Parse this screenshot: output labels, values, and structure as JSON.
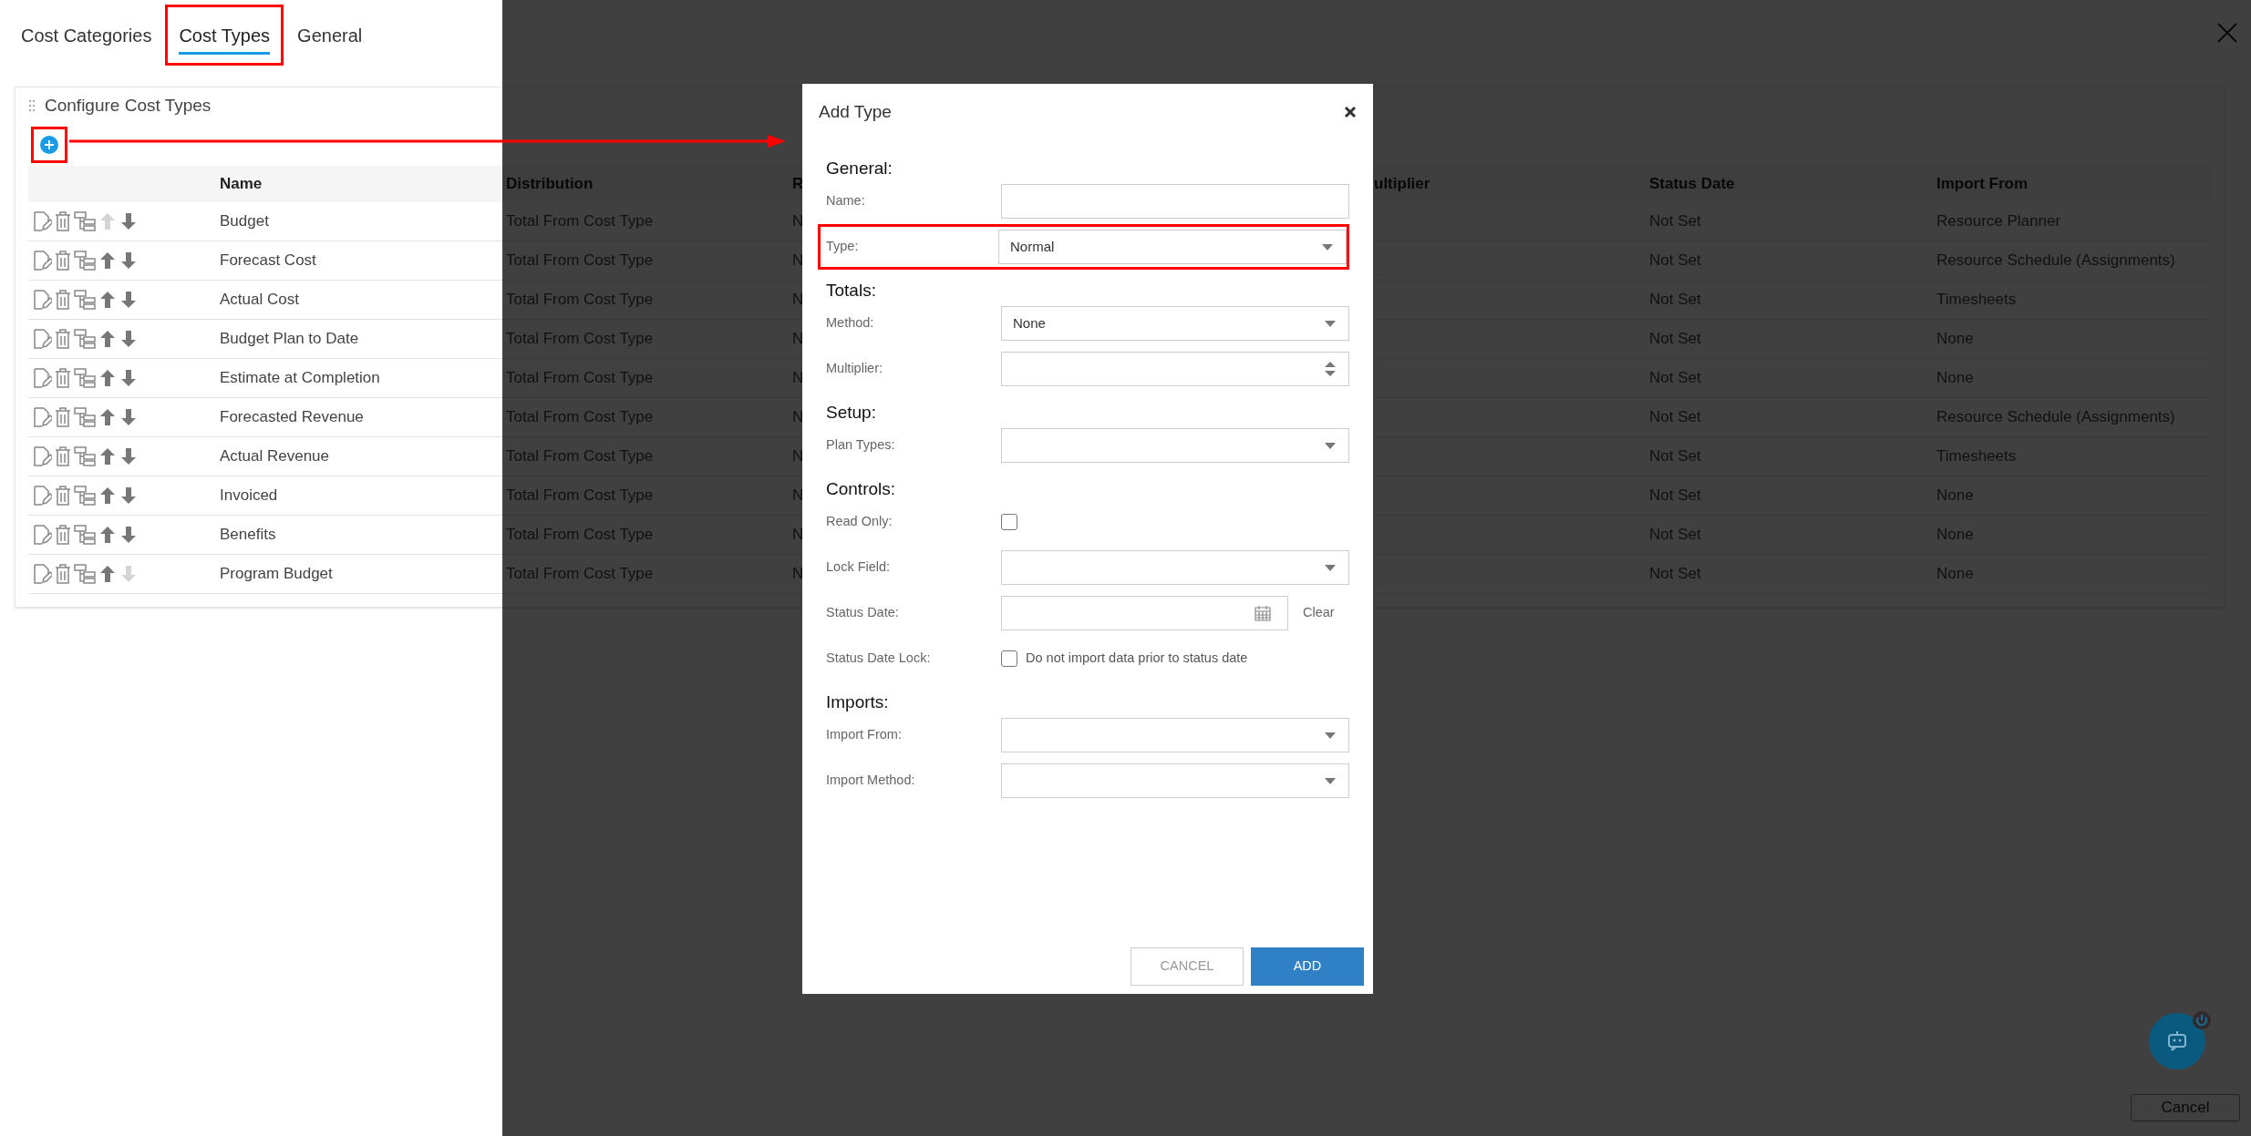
{
  "tabs": [
    {
      "label": "Cost Categories",
      "selected": false,
      "annotated": false
    },
    {
      "label": "Cost Types",
      "selected": true,
      "annotated": true
    },
    {
      "label": "General",
      "selected": false,
      "annotated": false
    }
  ],
  "panel": {
    "title": "Configure Cost Types",
    "add_button_annotated": true
  },
  "table": {
    "columns": [
      "Name",
      "Distribution",
      "R",
      "ultiplier",
      "Status Date",
      "Import From"
    ],
    "rows": [
      {
        "name": "Budget",
        "distribution": "Total From Cost Type",
        "column_3": "N",
        "status_date": "Not Set",
        "import_from": "Resource Planner",
        "can_move_up": false,
        "can_move_down": true
      },
      {
        "name": "Forecast Cost",
        "distribution": "Total From Cost Type",
        "column_3": "N",
        "status_date": "Not Set",
        "import_from": "Resource Schedule (Assignments)",
        "can_move_up": true,
        "can_move_down": true
      },
      {
        "name": "Actual Cost",
        "distribution": "Total From Cost Type",
        "column_3": "N",
        "status_date": "Not Set",
        "import_from": "Timesheets",
        "can_move_up": true,
        "can_move_down": true
      },
      {
        "name": "Budget Plan to Date",
        "distribution": "Total From Cost Type",
        "column_3": "N",
        "status_date": "Not Set",
        "import_from": "None",
        "can_move_up": true,
        "can_move_down": true
      },
      {
        "name": "Estimate at Completion",
        "distribution": "Total From Cost Type",
        "column_3": "N",
        "status_date": "Not Set",
        "import_from": "None",
        "can_move_up": true,
        "can_move_down": true
      },
      {
        "name": "Forecasted Revenue",
        "distribution": "Total From Cost Type",
        "column_3": "N",
        "status_date": "Not Set",
        "import_from": "Resource Schedule (Assignments)",
        "can_move_up": true,
        "can_move_down": true
      },
      {
        "name": "Actual Revenue",
        "distribution": "Total From Cost Type",
        "column_3": "N",
        "status_date": "Not Set",
        "import_from": "Timesheets",
        "can_move_up": true,
        "can_move_down": true
      },
      {
        "name": "Invoiced",
        "distribution": "Total From Cost Type",
        "column_3": "N",
        "status_date": "Not Set",
        "import_from": "None",
        "can_move_up": true,
        "can_move_down": true
      },
      {
        "name": "Benefits",
        "distribution": "Total From Cost Type",
        "column_3": "N",
        "status_date": "Not Set",
        "import_from": "None",
        "can_move_up": true,
        "can_move_down": true
      },
      {
        "name": "Program Budget",
        "distribution": "Total From Cost Type",
        "column_3": "N",
        "status_date": "Not Set",
        "import_from": "None",
        "can_move_up": true,
        "can_move_down": false
      }
    ]
  },
  "dialog": {
    "title": "Add Type",
    "sections": [
      {
        "heading": "General:",
        "fields": [
          {
            "label": "Name:",
            "kind": "text",
            "highlighted": false
          },
          {
            "label": "Type:",
            "kind": "select",
            "value": "Normal",
            "highlighted": true
          }
        ]
      },
      {
        "heading": "Totals:",
        "fields": [
          {
            "label": "Method:",
            "kind": "select",
            "value": "None",
            "highlighted": false
          },
          {
            "label": "Multiplier:",
            "kind": "number",
            "highlighted": false
          }
        ]
      },
      {
        "heading": "Setup:",
        "fields": [
          {
            "label": "Plan Types:",
            "kind": "select",
            "highlighted": false
          }
        ]
      },
      {
        "heading": "Controls:",
        "fields": [
          {
            "label": "Read Only:",
            "kind": "checkbox",
            "checked": false,
            "highlighted": false
          },
          {
            "label": "Lock Field:",
            "kind": "select",
            "highlighted": false
          },
          {
            "label": "Status Date:",
            "kind": "date",
            "action": "Clear",
            "highlighted": false
          },
          {
            "label": "Status Date Lock:",
            "kind": "checkbox",
            "checked": false,
            "caption": "Do not import data prior to status date",
            "highlighted": false
          }
        ]
      },
      {
        "heading": "Imports:",
        "fields": [
          {
            "label": "Import From:",
            "kind": "select",
            "highlighted": false
          },
          {
            "label": "Import Method:",
            "kind": "select",
            "highlighted": false
          }
        ]
      }
    ],
    "buttons": [
      {
        "label": "CANCEL",
        "kind": "secondary"
      },
      {
        "label": "ADD",
        "kind": "primary"
      }
    ]
  },
  "cancel_button": "Cancel"
}
